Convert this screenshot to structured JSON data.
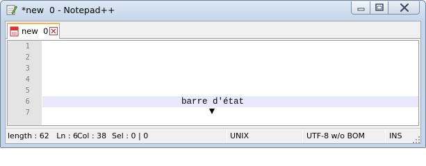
{
  "window": {
    "title": "*new  0 - Notepad++"
  },
  "tabs": [
    {
      "label": "new  0",
      "icon": "unsaved-file-icon",
      "active": true
    }
  ],
  "editor": {
    "line_numbers": [
      "1",
      "2",
      "3",
      "4",
      "5",
      "6",
      "7"
    ],
    "lines": [
      "",
      "",
      "",
      "",
      "",
      "barre d'état",
      ""
    ],
    "current_line": 6,
    "annotation_marker": "down-arrow"
  },
  "statusbar": {
    "length_ln": "length : 62   Ln : 6",
    "col": "Col : 38",
    "sel": "Sel : 0 | 0",
    "eol": "UNIX",
    "encoding": "UTF-8 w/o BOM",
    "mode": "INS"
  },
  "colors": {
    "tab_accent": "#fab64a",
    "current_line_bg": "#e8e8ff",
    "gutter_bg": "#e4e4e4",
    "titlebar": "#c6d7ea"
  }
}
